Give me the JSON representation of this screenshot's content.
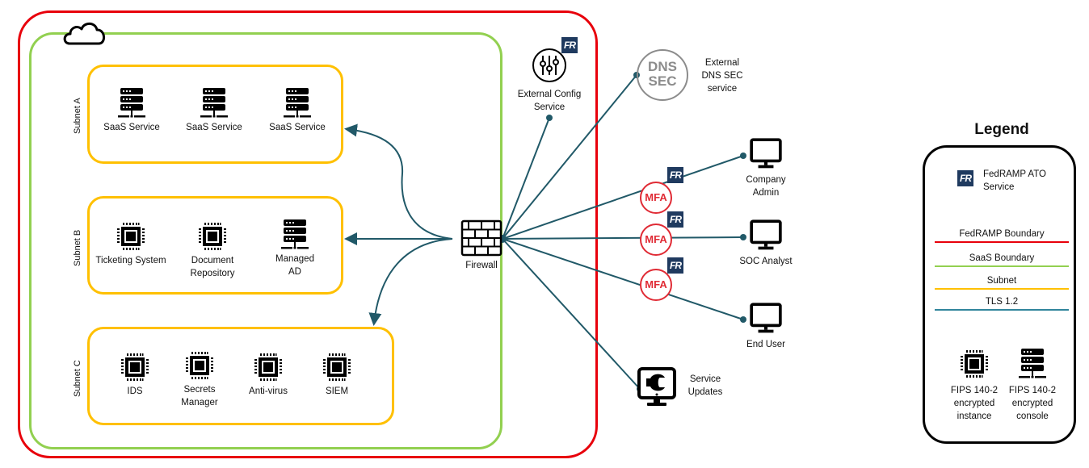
{
  "colors": {
    "fedramp_boundary": "#e8000b",
    "saas_boundary": "#92d050",
    "subnet": "#ffc000",
    "tls": "#215968",
    "mfa": "#e02b35",
    "fedramp_badge": "#1f3a5f",
    "dnssec_gray": "#8c8c8c"
  },
  "subnets": [
    {
      "label": "Subnet A",
      "nodes": [
        {
          "label": "SaaS Service",
          "icon": "server-icon"
        },
        {
          "label": "SaaS Service",
          "icon": "server-icon"
        },
        {
          "label": "SaaS Service",
          "icon": "server-icon"
        }
      ]
    },
    {
      "label": "Subnet B",
      "nodes": [
        {
          "label": "Ticketing System",
          "icon": "chip-icon"
        },
        {
          "label": "Document Repository",
          "icon": "chip-icon"
        },
        {
          "label": "Managed AD",
          "icon": "server-icon"
        }
      ]
    },
    {
      "label": "Subnet C",
      "nodes": [
        {
          "label": "IDS",
          "icon": "chip-icon"
        },
        {
          "label": "Secrets Manager",
          "icon": "chip-icon"
        },
        {
          "label": "Anti-virus",
          "icon": "chip-icon"
        },
        {
          "label": "SIEM",
          "icon": "chip-icon"
        }
      ]
    }
  ],
  "firewall": {
    "label": "Firewall"
  },
  "external_config": {
    "label": "External Config Service"
  },
  "dnssec": {
    "icon_text_1": "DNS",
    "icon_text_2": "SEC",
    "label": "External DNS SEC service"
  },
  "mfa_label": "MFA",
  "fr_badge_text": "FR",
  "endpoints": [
    {
      "label": "Company Admin"
    },
    {
      "label": "SOC Analyst"
    },
    {
      "label": "End User"
    }
  ],
  "service_updates": {
    "label": "Service Updates"
  },
  "legend": {
    "title": "Legend",
    "fedramp_ato": "FedRAMP ATO Service",
    "lines": [
      {
        "label": "FedRAMP Boundary",
        "color": "#e8000b"
      },
      {
        "label": "SaaS Boundary",
        "color": "#92d050"
      },
      {
        "label": "Subnet",
        "color": "#ffc000"
      },
      {
        "label": "TLS 1.2",
        "color": "#31859c"
      }
    ],
    "fips_instance": "FIPS 140-2 encrypted instance",
    "fips_console": "FIPS 140-2 encrypted console"
  }
}
